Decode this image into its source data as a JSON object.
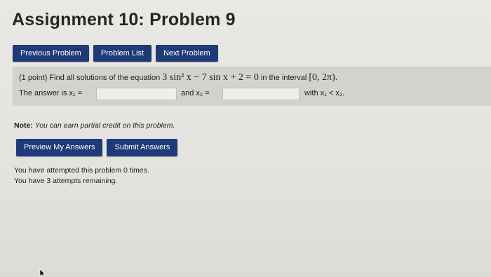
{
  "page": {
    "title": "Assignment 10: Problem 9"
  },
  "nav": {
    "previous": "Previous Problem",
    "list": "Problem List",
    "next": "Next Problem"
  },
  "problem": {
    "points": "(1 point)",
    "prompt": "Find all solutions of the equation",
    "equation": "3 sin² x − 7 sin x + 2 = 0",
    "interval_text": "in the interval",
    "interval": "[0, 2π).",
    "answer_label_1": "The answer is x₁ =",
    "answer_value_1": "",
    "answer_label_2": "and x₂ =",
    "answer_value_2": "",
    "condition": "with x₁ < x₂."
  },
  "note": {
    "label": "Note:",
    "text": "You can earn partial credit on this problem."
  },
  "actions": {
    "preview": "Preview My Answers",
    "submit": "Submit Answers"
  },
  "status": {
    "attempted": "You have attempted this problem 0 times.",
    "remaining": "You have 3 attempts remaining."
  },
  "colors": {
    "button_bg": "#1f3a78",
    "problem_bg": "#d4d2cc"
  }
}
